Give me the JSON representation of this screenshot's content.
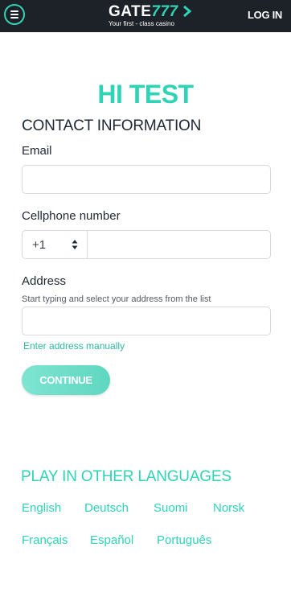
{
  "header": {
    "menu_icon": "hamburger-menu-icon",
    "logo_gate": "GATE",
    "logo_number": "777",
    "logo_tagline": "Your first - class casino",
    "login_label": "LOG IN"
  },
  "greeting": "HI TEST",
  "contact": {
    "title": "CONTACT INFORMATION",
    "email_label": "Email",
    "email_value": "",
    "phone_label": "Cellphone number",
    "country_code": "+1",
    "phone_value": "",
    "address_label": "Address",
    "address_hint": "Start typing and select your address from the list",
    "address_value": "",
    "manual_link": "Enter address manually",
    "continue_label": "CONTINUE"
  },
  "languages": {
    "title": "PLAY IN OTHER LANGUAGES",
    "items": [
      "English",
      "Deutsch",
      "Suomi",
      "Norsk",
      "Français",
      "Español",
      "Português"
    ]
  },
  "colors": {
    "accent": "#2fd3b6",
    "header_bg": "#1d2229",
    "text": "#1f2733"
  }
}
